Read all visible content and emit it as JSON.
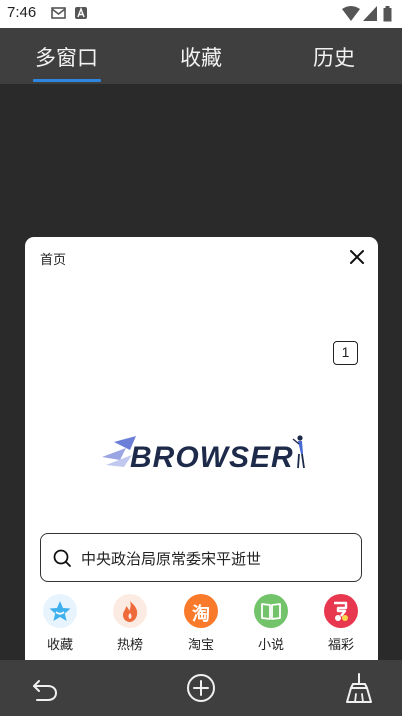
{
  "status_bar": {
    "time": "7:46"
  },
  "tabs": [
    {
      "label": "多窗口",
      "active": true
    },
    {
      "label": "收藏",
      "active": false
    },
    {
      "label": "历史",
      "active": false
    }
  ],
  "window_card": {
    "title": "首页",
    "tab_count": "1",
    "logo_text": "BROWSER",
    "search_text": "中央政治局原常委宋平逝世",
    "shortcuts": [
      {
        "label": "收藏",
        "icon": "star-icon",
        "color": "#e7f4fd"
      },
      {
        "label": "热榜",
        "icon": "flame-icon",
        "color": "#fcebe3"
      },
      {
        "label": "淘宝",
        "icon": "taobao-icon",
        "color": "#f97a2b"
      },
      {
        "label": "小说",
        "icon": "book-icon",
        "color": "#72c36a"
      },
      {
        "label": "福彩",
        "icon": "lottery-icon",
        "color": "#e8384f"
      }
    ],
    "shortcut_glyphs": {
      "taobao": "淘"
    }
  },
  "colors": {
    "accent": "#2f86e0",
    "bar_bg": "#3f3f3f",
    "content_bg": "#2a2a2a"
  }
}
